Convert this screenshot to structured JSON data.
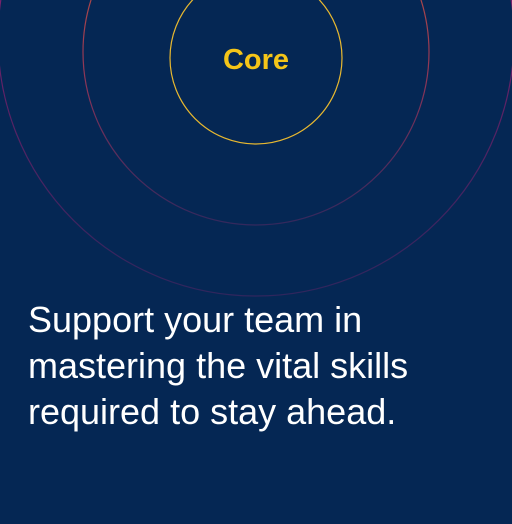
{
  "core": {
    "label": "Core"
  },
  "tagline": {
    "line1": "Support your team in",
    "line2": "mastering the vital skills",
    "line3": "required to stay ahead."
  },
  "colors": {
    "background": "#052754",
    "core_text": "#F5C518",
    "tagline_text": "#FFFFFF",
    "inner_ring": "#E8B830",
    "middle_ring": "#E0662E",
    "outer_ring": "#A8206B"
  }
}
